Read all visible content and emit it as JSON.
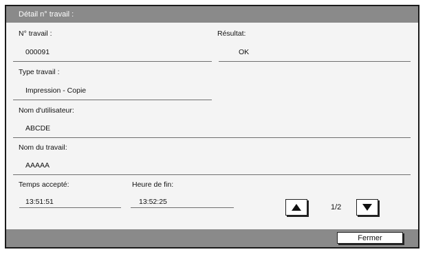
{
  "dialog": {
    "title": "Détail n° travail :",
    "close_label": "Fermer"
  },
  "fields": {
    "job_number": {
      "label": "N° travail :",
      "value": "000091"
    },
    "result": {
      "label": "Résultat:",
      "value": "OK"
    },
    "job_type": {
      "label": "Type travail :",
      "value": "Impression - Copie"
    },
    "user_name": {
      "label": "Nom d'utilisateur:",
      "value": "ABCDE"
    },
    "job_name": {
      "label": "Nom du travail:",
      "value": "AAAAA"
    },
    "accepted_time": {
      "label": "Temps accepté:",
      "value": "13:51:51"
    },
    "end_time": {
      "label": "Heure de fin:",
      "value": "13:52:25"
    }
  },
  "pagination": {
    "indicator": "1/2",
    "up_icon": "arrow-up-icon",
    "down_icon": "arrow-down-icon"
  }
}
